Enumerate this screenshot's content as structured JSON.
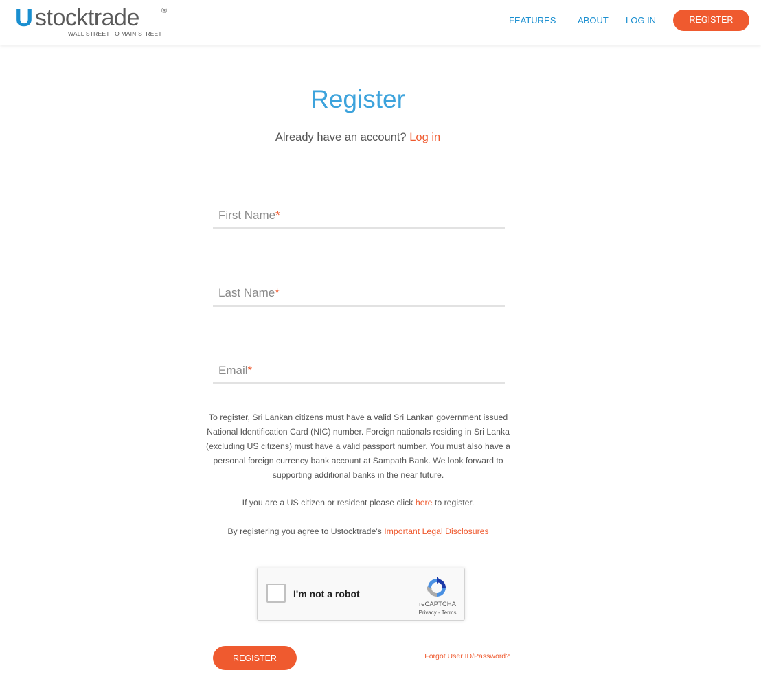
{
  "header": {
    "logo": {
      "letter": "U",
      "word": "stocktrade",
      "registered": "®",
      "tagline": "WALL STREET TO MAIN STREET"
    },
    "nav": {
      "features": "FEATURES",
      "about": "ABOUT",
      "login": "LOG IN",
      "register": "REGISTER"
    }
  },
  "main": {
    "title": "Register",
    "subtitle": {
      "text": "Already have an account?",
      "link": "Log in"
    },
    "fields": {
      "first_name": {
        "label": "First Name",
        "required": "*",
        "value": ""
      },
      "last_name": {
        "label": "Last Name",
        "required": "*",
        "value": ""
      },
      "email": {
        "label": "Email",
        "required": "*",
        "value": ""
      }
    },
    "notice": "To register, Sri Lankan citizens must have a valid Sri Lankan government issued National Identification Card (NIC) number. Foreign nationals residing in Sri Lanka (excluding US citizens) must have a valid passport number. You must also have a personal foreign currency bank account at Sampath Bank. We look forward to supporting additional banks in the near future.",
    "us_line": {
      "before": "If you are a US citizen or resident please click ",
      "link": "here",
      "after": " to register."
    },
    "legal_line": {
      "before": "By registering you agree to Ustocktrade's ",
      "link": "Important Legal Disclosures"
    },
    "recaptcha": {
      "label": "I'm not a robot",
      "brand": "reCAPTCHA",
      "terms": "Privacy - Terms"
    },
    "register_button": "REGISTER",
    "forgot_link": "Forgot User ID/Password?"
  },
  "colors": {
    "accent_blue": "#1a8fd0",
    "accent_orange": "#ef5a2f"
  }
}
